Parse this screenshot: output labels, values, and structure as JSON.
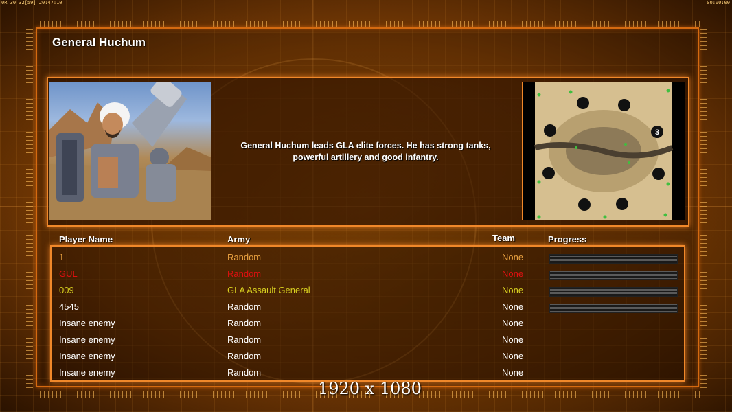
{
  "hud": {
    "left_text": "0R 30 32[59] 20:47:10",
    "right_text": "00:00:00"
  },
  "title": "General Huchum",
  "description": "General Huchum leads GLA elite forces. He has strong tanks, powerful artillery and good infantry.",
  "map": {
    "player_count_badge": "3"
  },
  "columns": {
    "player": "Player Name",
    "army": "Army",
    "team": "Team",
    "progress": "Progress"
  },
  "players": [
    {
      "name": "1",
      "army": "Random",
      "team": "None",
      "color": "#e8a040",
      "progress": true
    },
    {
      "name": "GUL",
      "army": "Random",
      "team": "None",
      "color": "#e01010",
      "progress": true
    },
    {
      "name": "009",
      "army": "GLA Assault General",
      "team": "None",
      "color": "#d8d020",
      "progress": true
    },
    {
      "name": "4545",
      "army": "Random",
      "team": "None",
      "color": "#ffffff",
      "progress": true
    },
    {
      "name": "Insane enemy",
      "army": "Random",
      "team": "None",
      "color": "#ffffff",
      "progress": false
    },
    {
      "name": "Insane enemy",
      "army": "Random",
      "team": "None",
      "color": "#ffffff",
      "progress": false
    },
    {
      "name": "Insane enemy",
      "army": "Random",
      "team": "None",
      "color": "#ffffff",
      "progress": false
    },
    {
      "name": "Insane enemy",
      "army": "Random",
      "team": "None",
      "color": "#ffffff",
      "progress": false
    }
  ],
  "resolution_label": "1920 x 1080"
}
